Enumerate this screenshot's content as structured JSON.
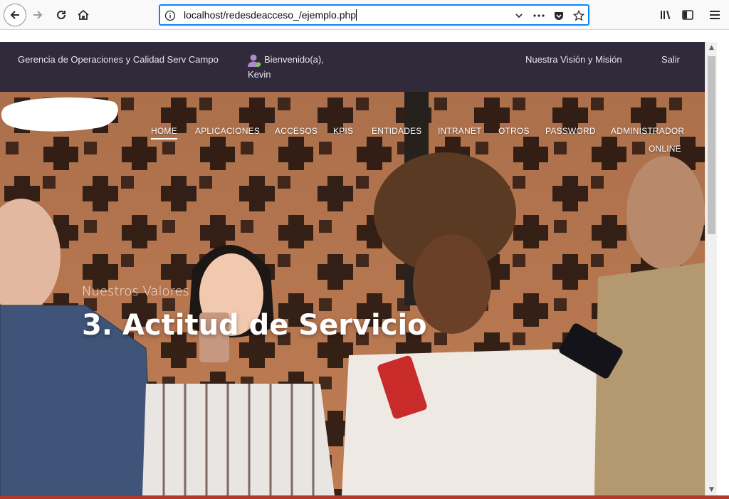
{
  "browser": {
    "url": "localhost/redesdeacceso_/ejemplo.php"
  },
  "site": {
    "brand": "Gerencia de Operaciones y Calidad Serv Campo",
    "welcome": "Bienvenido(a),",
    "username": "Kevin",
    "vision_link": "Nuestra Visión y Misión",
    "logout": "Salir"
  },
  "nav": {
    "items": [
      {
        "label": "HOME",
        "active": true
      },
      {
        "label": "APLICACIONES"
      },
      {
        "label": "ACCESOS"
      },
      {
        "label": "KPIS"
      },
      {
        "label": "ENTIDADES"
      },
      {
        "label": "INTRANET"
      },
      {
        "label": "OTROS"
      },
      {
        "label": "PASSWORD"
      },
      {
        "label": "ADMINISTRADOR"
      },
      {
        "label": "ONLINE"
      }
    ]
  },
  "hero": {
    "subtitle": "Nuestros Valores",
    "title": "3. Actitud de Servicio"
  },
  "colors": {
    "header_bg": "#302a3a",
    "hero_bg": "#b7703f",
    "url_focus": "#0a84ff"
  },
  "icons": [
    "back-icon",
    "forward-icon",
    "reload-icon",
    "home-icon",
    "info-icon",
    "chevron-down-icon",
    "more-icon",
    "pocket-icon",
    "star-icon",
    "library-icon",
    "sidebar-icon",
    "menu-icon",
    "user-icon"
  ]
}
